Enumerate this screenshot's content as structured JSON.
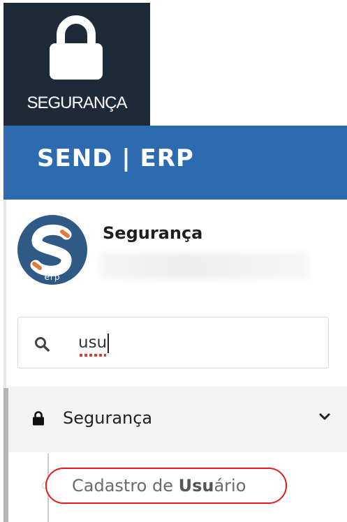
{
  "module_tile": {
    "label": "SEGURANÇA",
    "icon": "lock-icon"
  },
  "header": {
    "brand": "SEND | ERP"
  },
  "profile": {
    "name": "Segurança",
    "avatar_text": "erp"
  },
  "search": {
    "value": "usu",
    "icon": "search-icon"
  },
  "menu": {
    "group_label": "Segurança",
    "group_icon": "lock-icon",
    "expand_icon": "chevron-down-icon",
    "items": [
      {
        "prefix": "Cadastro de ",
        "highlight": "Usu",
        "suffix": "ário"
      }
    ]
  },
  "colors": {
    "tile_bg": "#1e2a38",
    "header_bg": "#2d6bb0",
    "avatar_bg": "#2f5a86",
    "avatar_accent": "#e07a3a",
    "highlight_ring": "#e01b1b"
  }
}
